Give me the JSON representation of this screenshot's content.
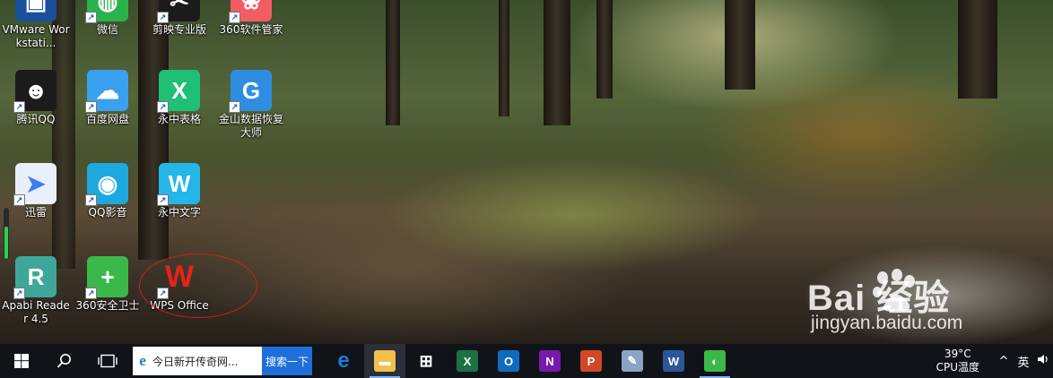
{
  "desktop": {
    "icons": [
      {
        "label": "VMware Workstati...",
        "icon": "vmware-icon",
        "color": "#1a4f9c",
        "glyph": "▣",
        "shortcut": false
      },
      {
        "label": "微信",
        "icon": "wechat-icon",
        "color": "#2bb24c",
        "glyph": "◍",
        "shortcut": true
      },
      {
        "label": "剪映专业版",
        "icon": "jianying-icon",
        "color": "#1b1b1b",
        "glyph": "✂",
        "shortcut": true
      },
      {
        "label": "360软件管家",
        "icon": "360-software-icon",
        "color": "#f25d63",
        "glyph": "❀",
        "shortcut": true
      },
      {
        "label": "腾讯QQ",
        "icon": "qq-penguin-icon",
        "color": "#1b1b1b",
        "glyph": "☻",
        "shortcut": true
      },
      {
        "label": "百度网盘",
        "icon": "baidu-netdisk-icon",
        "color": "#3aa0f0",
        "glyph": "☁",
        "shortcut": true
      },
      {
        "label": "永中表格",
        "icon": "yozo-sheet-icon",
        "color": "#1fbf76",
        "glyph": "X",
        "shortcut": true
      },
      {
        "label": "金山数据恢复大师",
        "icon": "kingsoft-recovery-icon",
        "color": "#2e8de0",
        "glyph": "G",
        "shortcut": true
      },
      {
        "label": "迅雷",
        "icon": "xunlei-icon",
        "color": "#e9f0fb",
        "glyph": "➤",
        "shortcut": true
      },
      {
        "label": "QQ影音",
        "icon": "qq-player-icon",
        "color": "#1fa8e0",
        "glyph": "◉",
        "shortcut": true
      },
      {
        "label": "永中文字",
        "icon": "yozo-writer-icon",
        "color": "#23b6e6",
        "glyph": "W",
        "shortcut": true
      },
      {
        "label": "Apabi Reader 4.5",
        "icon": "apabi-reader-icon",
        "color": "#3fa79a",
        "glyph": "R",
        "shortcut": true
      },
      {
        "label": "360安全卫士",
        "icon": "360-safe-icon",
        "color": "#3bb84a",
        "glyph": "+",
        "shortcut": true
      },
      {
        "label": "WPS Office",
        "icon": "wps-office-icon",
        "color": "#e5231b",
        "glyph": "W",
        "shortcut": true
      }
    ]
  },
  "watermark": {
    "logo": "Bai  经验",
    "url": "jingyan.baidu.com"
  },
  "taskbar": {
    "search_text": "今日新开传奇网...",
    "search_button": "搜索一下",
    "apps": [
      {
        "name": "edge",
        "icon": "edge-icon",
        "glyph": "e",
        "color": "#1c7ad6"
      },
      {
        "name": "file-explorer",
        "icon": "folder-icon",
        "glyph": "▬",
        "color": "#f2c04a"
      },
      {
        "name": "store",
        "icon": "store-bag-icon",
        "glyph": "⊞",
        "color": "#ffffff"
      },
      {
        "name": "excel",
        "icon": "excel-icon",
        "glyph": "X",
        "color": "#1e7145"
      },
      {
        "name": "outlook",
        "icon": "outlook-icon",
        "glyph": "O",
        "color": "#0f6cbd"
      },
      {
        "name": "onenote",
        "icon": "onenote-icon",
        "glyph": "N",
        "color": "#7719aa"
      },
      {
        "name": "powerpoint",
        "icon": "powerpoint-icon",
        "glyph": "P",
        "color": "#d24726"
      },
      {
        "name": "paint",
        "icon": "paint-palette-icon",
        "glyph": "✎",
        "color": "#8aa3c7"
      },
      {
        "name": "word",
        "icon": "word-icon",
        "glyph": "W",
        "color": "#2b579a"
      },
      {
        "name": "360-browser",
        "icon": "360-browser-icon",
        "glyph": "◐",
        "color": "#3bb84a"
      }
    ],
    "cpu_temp": "39°C",
    "cpu_label": "CPU温度",
    "tray": {
      "chevron": "^",
      "ime": "英"
    }
  }
}
